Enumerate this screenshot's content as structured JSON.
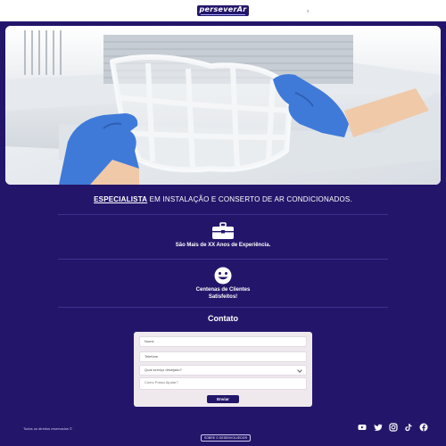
{
  "header": {
    "logo_text": "perseverAr",
    "close_glyph": "x"
  },
  "hero": {
    "image_alt": "gloved hands removing an air conditioner filter"
  },
  "headline": {
    "strong": "ESPECIALISTA",
    "rest": " EM INSTALAÇÃO E CONSERTO DE AR CONDICIONADOS."
  },
  "features": [
    {
      "icon": "briefcase-icon",
      "text": "São Mais de XX Anos de Experiência."
    },
    {
      "icon": "smile-icon",
      "line1": "Centenas de Clientes",
      "line2": "Satisfeitos!"
    }
  ],
  "contact": {
    "title": "Contato",
    "name_placeholder": "Nome",
    "phone_placeholder": "Telefone",
    "service_select_value": "Qual serviço desejado?",
    "message_placeholder": "Como Posso Ajudar?",
    "submit_label": "Enviar"
  },
  "footer": {
    "rights": "Todos os direitos reservados ©",
    "dev_link": "SOBRE O DESENVOLVEDOR"
  },
  "social": [
    "youtube-icon",
    "twitter-icon",
    "instagram-icon",
    "tiktok-icon",
    "facebook-icon"
  ],
  "colors": {
    "brand": "#23166a",
    "background": "#23166a",
    "form_bg": "#efe9ee",
    "glove": "#3f7ad9"
  }
}
